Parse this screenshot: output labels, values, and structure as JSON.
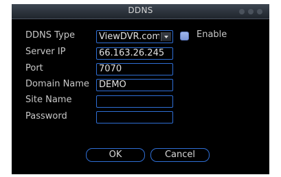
{
  "dialog": {
    "title": "DDNS"
  },
  "form": {
    "ddns_type": {
      "label": "DDNS Type",
      "value": "ViewDVR.com"
    },
    "enable": {
      "label": "Enable",
      "checked": true
    },
    "server_ip": {
      "label": "Server IP",
      "value": "66.163.26.245"
    },
    "port": {
      "label": "Port",
      "value": "7070"
    },
    "domain_name": {
      "label": "Domain Name",
      "value": "DEMO"
    },
    "site_name": {
      "label": "Site Name",
      "value": ""
    },
    "password": {
      "label": "Password",
      "value": ""
    }
  },
  "buttons": {
    "ok_label": "OK",
    "cancel_label": "Cancel"
  },
  "colors": {
    "background": "#000000",
    "border_accent": "#2f6fd6",
    "checkbox": "#8aa3e2",
    "text": "#c8c8c8"
  }
}
